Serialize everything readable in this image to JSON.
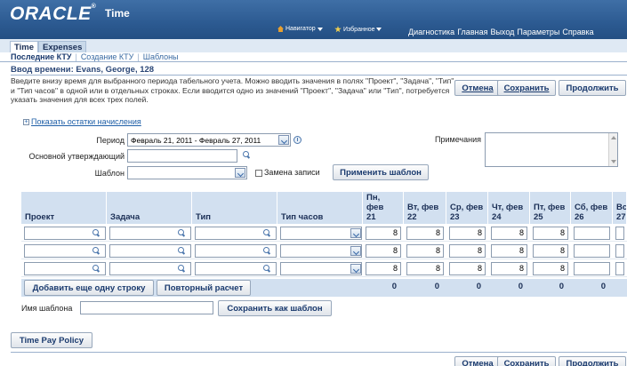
{
  "header": {
    "logo": "ORACLE",
    "app_title": "Time",
    "navigator": "Навигатор",
    "favorites": "Избранное",
    "global_links": [
      "Диагностика",
      "Главная",
      "Выход",
      "Параметры",
      "Справка"
    ]
  },
  "tabs": [
    {
      "label": "Time",
      "active": true
    },
    {
      "label": "Expenses",
      "active": false
    }
  ],
  "subtabs": {
    "items": [
      "Последние КТУ",
      "Создание КТУ",
      "Шаблоны"
    ],
    "separator": "|"
  },
  "page": {
    "title": "Ввод времени: Evans, George, 128",
    "instructions": "Введите внизу время для выбранного периода табельного учета. Можно вводить значения в полях \"Проект\", \"Задача\", \"Тип\" и \"Тип часов\" в одной или в отдельных строках. Если вводится одно из значений \"Проект\", \"Задача\" или \"Тип\", потребуется указать значения для всех трех полей."
  },
  "buttons": {
    "cancel": "Отмена",
    "save": "Сохранить",
    "continue": "Продолжить",
    "apply_template": "Применить шаблон",
    "add_row": "Добавить еще одну строку",
    "recalculate": "Повторный расчет",
    "save_template": "Сохранить как шаблон",
    "time_pay_policy": "Time Pay Policy"
  },
  "form": {
    "show_balances": "Показать остатки начисления",
    "period_label": "Период",
    "period_value": "Февраль 21, 2011 - Февраль 27, 2011",
    "approver_label": "Основной утверждающий",
    "approver_value": "",
    "template_label": "Шаблон",
    "template_value": "",
    "overwrite_label": "Замена записи",
    "notes_label": "Примечания",
    "template_name_label": "Имя шаблона",
    "template_name_value": ""
  },
  "grid": {
    "columns": [
      "Проект",
      "Задача",
      "Тип",
      "Тип часов"
    ],
    "days": [
      {
        "l1": "Пн, фев",
        "l2": "21"
      },
      {
        "l1": "Вт, фев",
        "l2": "22"
      },
      {
        "l1": "Ср, фев",
        "l2": "23"
      },
      {
        "l1": "Чт, фев",
        "l2": "24"
      },
      {
        "l1": "Пт, фев",
        "l2": "25"
      },
      {
        "l1": "Сб, фев",
        "l2": "26"
      },
      {
        "l1": "Вс, ф",
        "l2": "27"
      }
    ],
    "rows": [
      {
        "hours": [
          "8",
          "8",
          "8",
          "8",
          "8",
          "",
          ""
        ]
      },
      {
        "hours": [
          "8",
          "8",
          "8",
          "8",
          "8",
          "",
          ""
        ]
      },
      {
        "hours": [
          "8",
          "8",
          "8",
          "8",
          "8",
          "",
          ""
        ]
      }
    ],
    "totals": [
      "0",
      "0",
      "0",
      "0",
      "0",
      "0",
      ""
    ]
  }
}
